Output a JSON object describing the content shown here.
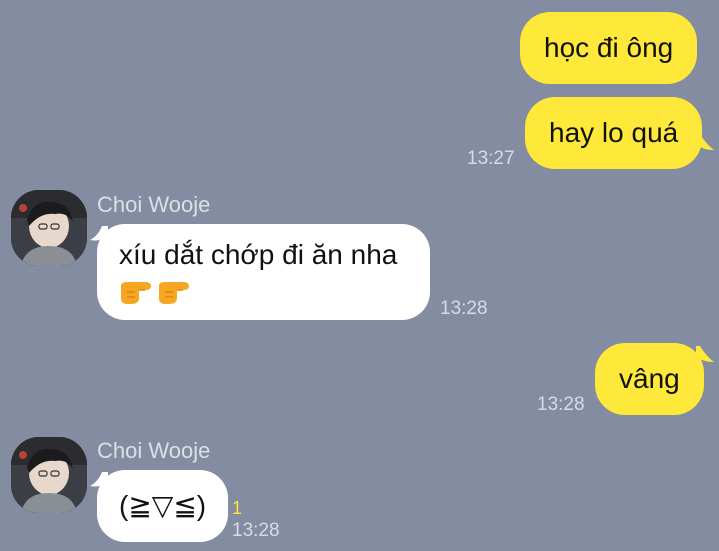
{
  "conversation": {
    "messages": [
      {
        "direction": "sent",
        "text": "học đi ông"
      },
      {
        "direction": "sent",
        "text": "hay lo quá",
        "time": "13:27"
      },
      {
        "direction": "received",
        "sender": "Choi Wooje",
        "text": "xíu dắt chớp đi ăn nha",
        "emoji": [
          "backhand-index-pointing-right",
          "backhand-index-pointing-right"
        ],
        "time": "13:28"
      },
      {
        "direction": "sent",
        "text": "vâng",
        "time": "13:28"
      },
      {
        "direction": "received",
        "sender": "Choi Wooje",
        "text": "(≧▽≦)",
        "unread": "1",
        "time": "13:28"
      }
    ]
  },
  "colors": {
    "background": "#838ca0",
    "sent_bubble": "#fee83a",
    "received_bubble": "#ffffff",
    "unread_count": "#fee83a"
  }
}
